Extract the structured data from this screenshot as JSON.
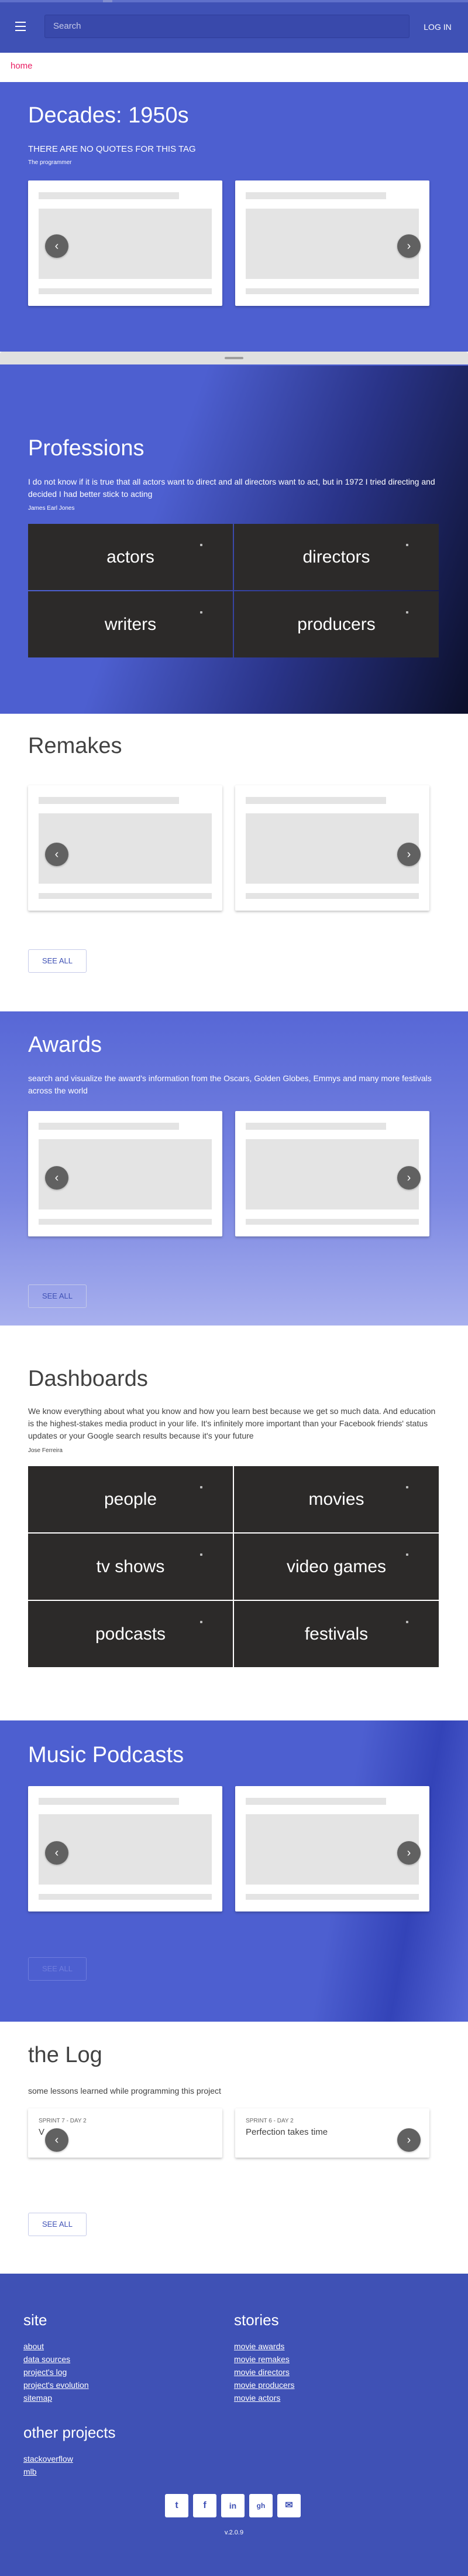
{
  "header": {
    "search_placeholder": "Search",
    "login_label": "LOG IN"
  },
  "breadcrumb": "home",
  "decades": {
    "title": "Decades: 1950s",
    "subtitle": "THERE ARE NO QUOTES FOR THIS TAG",
    "author": "The programmer"
  },
  "professions": {
    "title": "Professions",
    "quote": "I do not know if it is true that all actors want to direct and all directors want to act, but in 1972 I tried directing and decided I had better stick to acting",
    "author": "James Earl Jones",
    "tiles": [
      "actors",
      "directors",
      "writers",
      "producers"
    ]
  },
  "remakes": {
    "title": "Remakes",
    "see_all": "SEE ALL"
  },
  "awards": {
    "title": "Awards",
    "subtitle": "search and visualize the award's information from the Oscars, Golden Globes, Emmys and many more festivals across the world",
    "see_all": "SEE ALL"
  },
  "dashboards": {
    "title": "Dashboards",
    "quote": "We know everything about what you know and how you learn best because we get so much data. And education is the highest-stakes media product in your life. It's infinitely more important than your Facebook friends' status updates or your Google search results because it's your future",
    "author": "Jose Ferreira",
    "tiles": [
      "people",
      "movies",
      "tv shows",
      "video games",
      "podcasts",
      "festivals"
    ]
  },
  "music_podcasts": {
    "title": "Music Podcasts",
    "see_all": "SEE ALL"
  },
  "log": {
    "title": "the Log",
    "subtitle": "some lessons learned while programming this project",
    "cards": [
      {
        "kicker": "SPRINT 7 - DAY 2",
        "title": "V"
      },
      {
        "kicker": "SPRINT 6 - DAY 2",
        "title": "Perfection takes time"
      }
    ],
    "see_all": "SEE ALL"
  },
  "footer": {
    "site_heading": "site",
    "site_links": [
      "about",
      "data sources",
      "project's log",
      "project's evolution",
      "sitemap"
    ],
    "stories_heading": "stories",
    "stories_links": [
      "movie awards",
      "movie remakes",
      "movie directors",
      "movie producers",
      "movie actors"
    ],
    "other_heading": "other projects",
    "other_links": [
      "stackoverflow",
      "mlb"
    ],
    "social": [
      "twitter",
      "facebook",
      "linkedin",
      "github",
      "email"
    ],
    "social_glyphs": [
      "t",
      "f",
      "in",
      "gh",
      "✉"
    ],
    "version": "v.2.0.9"
  },
  "colors": {
    "primary": "#3f51b5",
    "accent": "#e91e63",
    "tile_bg": "#2c2a29"
  }
}
